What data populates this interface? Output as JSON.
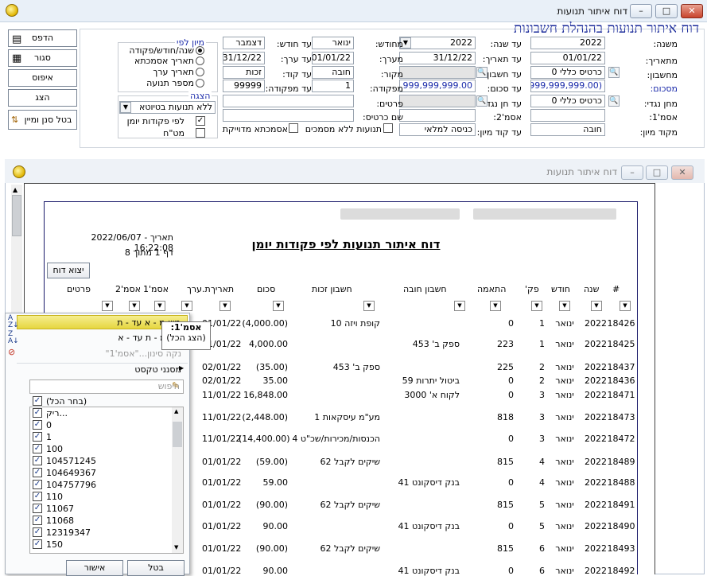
{
  "window": {
    "title": "דוח איתור תנועות"
  },
  "header": {
    "title": "דוח איתור תנועות בהנהלת חשבונות"
  },
  "side_buttons": [
    {
      "label": "הדפס",
      "icon": "printer-icon"
    },
    {
      "label": "סגור",
      "icon": "close-door-icon"
    },
    {
      "label": "איפוס",
      "icon": ""
    },
    {
      "label": "הצג",
      "icon": ""
    },
    {
      "label": "בטל סנן ומיין",
      "icon": "sort-filter-icon"
    }
  ],
  "form": {
    "mishna_label": "משנה:",
    "mishna_value": "2022",
    "ad_shana_label": "עד שנה:",
    "ad_shana_value": "2022",
    "mechodesh_label": "מחודש:",
    "mechodesh_value": "ינואר",
    "ad_chodesh_label": "עד חודש:",
    "ad_chodesh_value": "דצמבר",
    "mitaarich_label": "מתאריך:",
    "mitaarich_value": "01/01/22",
    "ad_taarich_label": "עד תאריך:",
    "ad_taarich_value": "31/12/22",
    "meerech_label": "מערך:",
    "meerech_value": "01/01/22",
    "ad_erech_label": "עד ערך:",
    "ad_erech_value": "31/12/22",
    "mecheshbon_label": "מחשבון:",
    "mecheshbon_value": "כרטיס כללי 0",
    "ad_cheshbon_label": "עד חשבון:",
    "makor_label": "מקור:",
    "makor_value": "חובה",
    "ad_kod_label": "עד קוד:",
    "ad_kod_value": "זכות",
    "misacum_label": "מסכום:",
    "misacum_value": "(999,999,999.00)",
    "ad_sacum_label": "עד סכום:",
    "ad_sacum_value": "999,999,999.00",
    "mifkuda_label": "מפקודה:",
    "mifkuda_value": "1",
    "ad_mifkuda_label": "עד מפקודה:",
    "ad_mifkuda_value": "99999",
    "mechen_naged_label": "מחן נגדי:",
    "mechen_naged_value": "כרטיס כללי 0",
    "ad_chen_naged_label": "עד חן נגדי:",
    "pratim_label": "פרטים:",
    "asmachta1_label": "אסמ'1:",
    "asmachta2_label": "אסמ'2:",
    "shem_kartis_label": "שם כרטיס:",
    "mikod_miyun_label": "מקוד מיון:",
    "mikod_miyun_value": "חובה",
    "ad_kod_miyun_label": "עד קוד מיון:",
    "ad_kod_miyun_value": "כניסה למלאי",
    "tnuot_lelo_label": "תנועות ללא מסמכים",
    "asmachta_meduyeket_label": "אסמכתא מדוייקת"
  },
  "sort": {
    "group_label": "מיון לפי",
    "options": [
      "שנה/חודש/פקודה",
      "תאריך אסמכתא",
      "תאריך ערך",
      "מספר תנועה"
    ],
    "selected": 0
  },
  "display": {
    "group_label": "הצגה",
    "select_value": "ללא תנועות בטיוטא",
    "opt1": "לפי פקודות יומן",
    "opt1_checked": true,
    "opt2": "מט\"ח",
    "opt2_checked": false
  },
  "inner_window": {
    "title": "דוח איתור תנועות"
  },
  "report": {
    "title": "דוח איתור תנועות לפי פקודות יומן",
    "date_line": "תאריך - 2022/06/07 16:22:08",
    "page_line": "דף 1 מתוך 8",
    "export_button": "יצוא דוח",
    "columns": [
      "#",
      "שנה",
      "חודש",
      "פק'",
      "התאמה",
      "חשבון חובה",
      "חשבון זכות",
      "סכום",
      "תאריך",
      "ת.ערך",
      "אסמ'1",
      "אסמ'2",
      "פרטים"
    ],
    "rows": [
      {
        "num": "18426",
        "year": "2022",
        "month": "ינואר",
        "pk": "1",
        "match": "0",
        "debit": "",
        "credit": "קופת ויזה  10",
        "amount": "(4,000.00)",
        "date": "01/01/22"
      },
      {
        "num": "18425",
        "year": "2022",
        "month": "ינואר",
        "pk": "1",
        "match": "223",
        "debit": "ספק ב'  453",
        "credit": "",
        "amount": "4,000.00",
        "date": "01/01/22"
      },
      {
        "num": "18437",
        "year": "2022",
        "month": "ינואר",
        "pk": "2",
        "match": "225",
        "debit": "",
        "credit": "ספק ב'  453",
        "amount": "(35.00)",
        "date": "02/01/22"
      },
      {
        "num": "18436",
        "year": "2022",
        "month": "ינואר",
        "pk": "2",
        "match": "0",
        "debit": "ביטול יתרות  59",
        "credit": "",
        "amount": "35.00",
        "date": "02/01/22"
      },
      {
        "num": "18471",
        "year": "2022",
        "month": "ינואר",
        "pk": "3",
        "match": "0",
        "debit": "לקוח א'  3000",
        "credit": "",
        "amount": "16,848.00",
        "date": "11/01/22"
      },
      {
        "num": "18473",
        "year": "2022",
        "month": "ינואר",
        "pk": "3",
        "match": "818",
        "debit": "",
        "credit": "מע\"מ עיסקאות  1",
        "amount": "(2,448.00)",
        "date": "11/01/22"
      },
      {
        "num": "18472",
        "year": "2022",
        "month": "ינואר",
        "pk": "3",
        "match": "0",
        "debit": "",
        "credit": "הכנסות/מכירות/שכ\"ט  4",
        "amount": "(14,400.00)",
        "date": "11/01/22"
      },
      {
        "num": "18489",
        "year": "2022",
        "month": "ינואר",
        "pk": "4",
        "match": "815",
        "debit": "",
        "credit": "שיקים לקבל  62",
        "amount": "(59.00)",
        "date": "01/01/22"
      },
      {
        "num": "18488",
        "year": "2022",
        "month": "ינואר",
        "pk": "4",
        "match": "0",
        "debit": "בנק דיסקונט  41",
        "credit": "",
        "amount": "59.00",
        "date": "01/01/22"
      },
      {
        "num": "18491",
        "year": "2022",
        "month": "ינואר",
        "pk": "5",
        "match": "815",
        "debit": "",
        "credit": "שיקים לקבל  62",
        "amount": "(90.00)",
        "date": "01/01/22"
      },
      {
        "num": "18490",
        "year": "2022",
        "month": "ינואר",
        "pk": "5",
        "match": "0",
        "debit": "בנק דיסקונט  41",
        "credit": "",
        "amount": "90.00",
        "date": "01/01/22"
      },
      {
        "num": "18493",
        "year": "2022",
        "month": "ינואר",
        "pk": "6",
        "match": "815",
        "debit": "",
        "credit": "שיקים לקבל  62",
        "amount": "(90.00)",
        "date": "01/01/22"
      },
      {
        "num": "18492",
        "year": "2022",
        "month": "ינואר",
        "pk": "6",
        "match": "0",
        "debit": "בנק דיסקונט  41",
        "credit": "",
        "amount": "90.00",
        "date": "01/01/22"
      }
    ]
  },
  "filter_menu": {
    "sort_asc": "מיון מ - א עד - ת",
    "sort_desc": "מיון מ - ת עד - א",
    "clear_filter": "נקה סינון...\"אסמ'1\"",
    "text_filters": "מסנני טקסט",
    "search_placeholder": "חיפוש",
    "items": [
      "(בחר הכל)",
      "ריק...",
      "0",
      "1",
      "100",
      "104571245",
      "104649367",
      "104757796",
      "110",
      "11067",
      "11068",
      "12319347",
      "150"
    ],
    "ok": "אישור",
    "cancel": "בטל"
  },
  "tooltip": {
    "line1": "אסמ'1:",
    "line2": "(הצג הכל)"
  }
}
